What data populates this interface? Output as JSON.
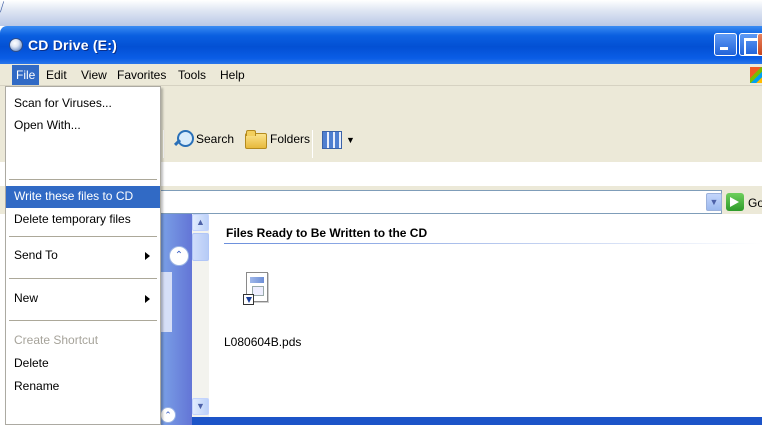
{
  "window": {
    "title": "CD Drive (E:)"
  },
  "menubar": {
    "items": [
      "File",
      "Edit",
      "View",
      "Favorites",
      "Tools",
      "Help"
    ]
  },
  "toolbar": {
    "search_label": "Search",
    "folders_label": "Folders"
  },
  "address": {
    "go_label": "Go"
  },
  "file_menu": {
    "items": [
      {
        "label": "Scan for Viruses...",
        "state": "normal"
      },
      {
        "label": "Open With...",
        "state": "normal"
      },
      {
        "label": "Write these files to CD",
        "state": "highlighted"
      },
      {
        "label": "Delete temporary files",
        "state": "normal"
      },
      {
        "label": "Send To",
        "state": "submenu"
      },
      {
        "label": "New",
        "state": "submenu"
      },
      {
        "label": "Create Shortcut",
        "state": "disabled"
      },
      {
        "label": "Delete",
        "state": "normal"
      },
      {
        "label": "Rename",
        "state": "normal"
      }
    ]
  },
  "content": {
    "group_title": "Files Ready to Be Written to the CD",
    "files": [
      {
        "name": "L080604B.pds"
      }
    ]
  },
  "colors": {
    "titlebar": "#0350d4",
    "menu_highlight": "#316ac5",
    "taskpane": "#7ba2e7"
  }
}
